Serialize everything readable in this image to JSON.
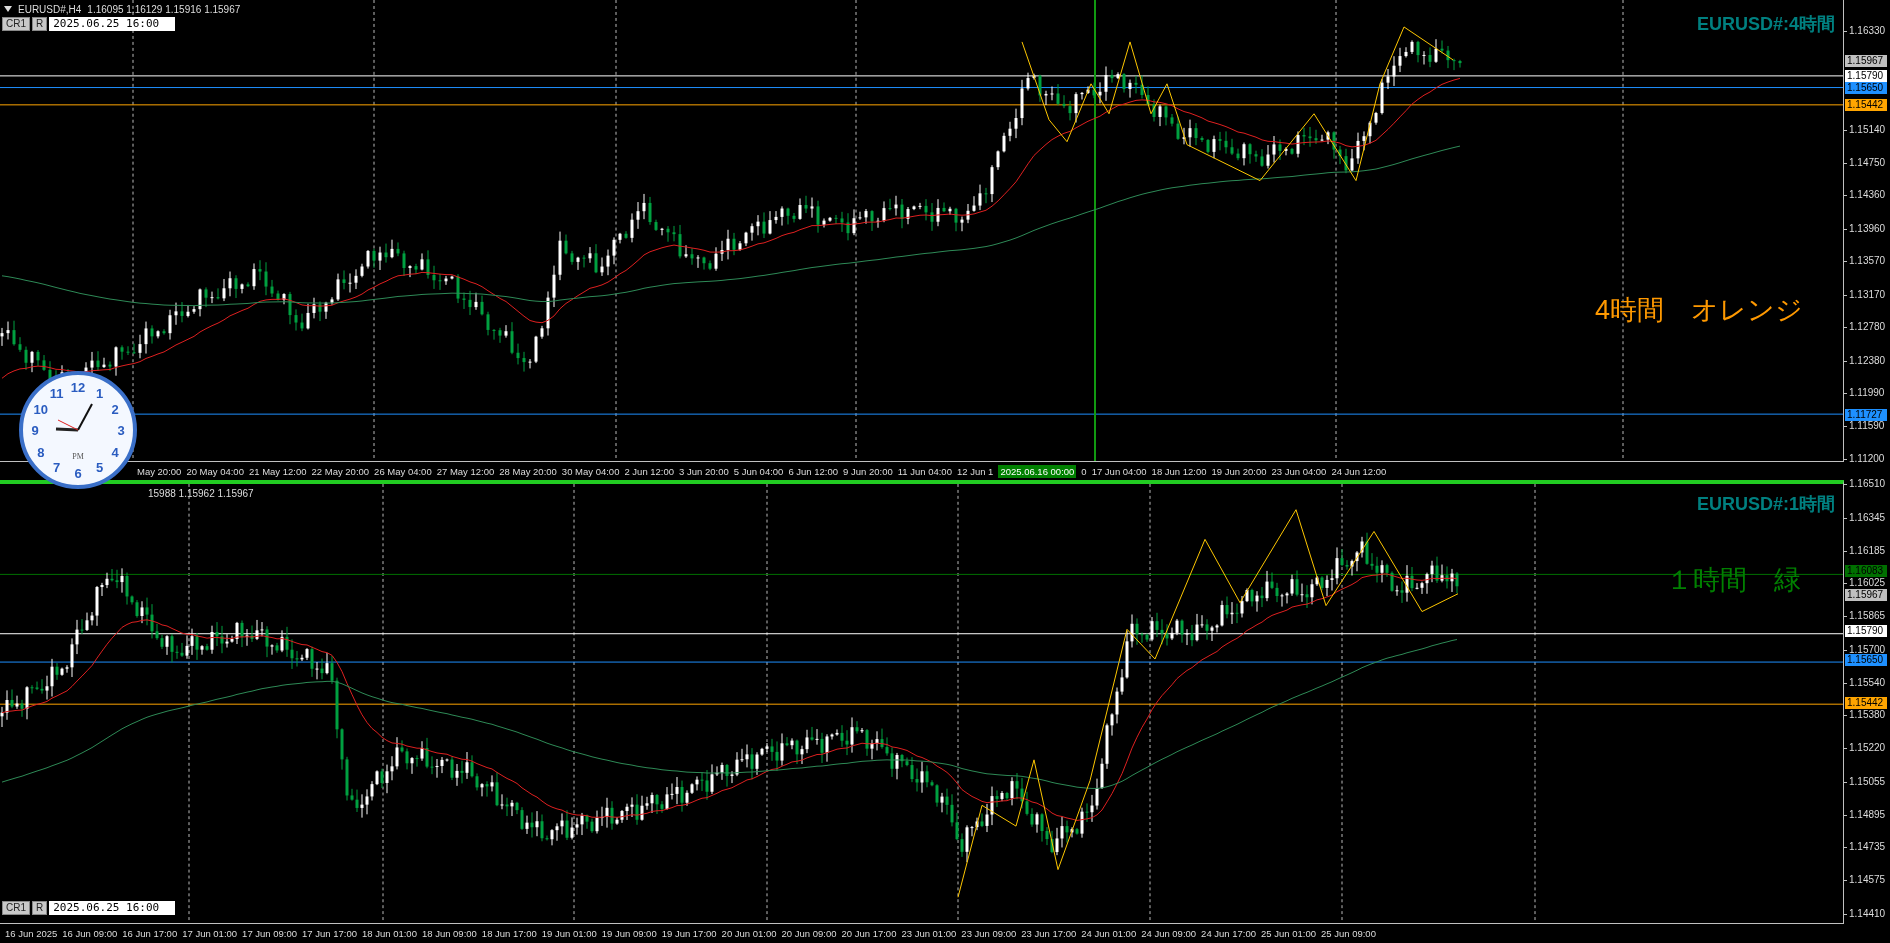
{
  "charts": [
    {
      "symbol": "EURUSD#,H4",
      "ohlc": "1.16095 1.16129 1.15916 1.15967",
      "active": false,
      "panel_buttons": [
        "CR1",
        "R"
      ],
      "date_field": "2025.06.25 16:00",
      "title": "EURUSD#:4時間",
      "note": {
        "text": "4時間　オレンジ",
        "color": "#ff9900"
      },
      "price_ticks": [
        "1.16330",
        "1.15140",
        "1.14750",
        "1.14360",
        "1.13960",
        "1.13570",
        "1.13170",
        "1.12780",
        "1.12380",
        "1.11990",
        "1.11590",
        "1.11200"
      ],
      "price_tags": [
        {
          "text": "1.15967",
          "kind": "bid",
          "color": "#c0c0c0"
        },
        {
          "text": "1.15790",
          "kind": "line",
          "color": "#ffffff"
        },
        {
          "text": "1.15650",
          "kind": "line",
          "color": "#1e90ff"
        },
        {
          "text": "1.15442",
          "kind": "line",
          "color": "#ffa500"
        },
        {
          "text": "1.11727",
          "kind": "line",
          "color": "#1e90ff"
        }
      ],
      "time_axis": [
        {
          "kind": "label",
          "text": "May 20:00"
        },
        {
          "kind": "label",
          "text": "20 May 04:00"
        },
        {
          "kind": "label",
          "text": "21 May 12:00"
        },
        {
          "kind": "label",
          "text": "22 May 20:00"
        },
        {
          "kind": "label",
          "text": "26 May 04:00"
        },
        {
          "kind": "label",
          "text": "27 May 12:00"
        },
        {
          "kind": "label",
          "text": "28 May 20:00"
        },
        {
          "kind": "label",
          "text": "30 May 04:00"
        },
        {
          "kind": "label",
          "text": "2 Jun 12:00"
        },
        {
          "kind": "label",
          "text": "3 Jun 20:00"
        },
        {
          "kind": "label",
          "text": "5 Jun 04:00"
        },
        {
          "kind": "label",
          "text": "6 Jun 12:00"
        },
        {
          "kind": "label",
          "text": "9 Jun 20:00"
        },
        {
          "kind": "label",
          "text": "11 Jun 04:00"
        },
        {
          "kind": "label",
          "text": "12 Jun 1"
        },
        {
          "kind": "cursor",
          "text": "2025.06.16 00:00"
        },
        {
          "kind": "label",
          "text": "0"
        },
        {
          "kind": "label",
          "text": "17 Jun 04:00"
        },
        {
          "kind": "label",
          "text": "18 Jun 12:00"
        },
        {
          "kind": "label",
          "text": "19 Jun 20:00"
        },
        {
          "kind": "label",
          "text": "23 Jun 04:00"
        },
        {
          "kind": "label",
          "text": "24 Jun 12:00"
        }
      ]
    },
    {
      "ohlc": "15988 1.15962 1.15967",
      "active": true,
      "panel_buttons": [
        "CR1",
        "R"
      ],
      "date_field": "2025.06.25 16:00",
      "title": "EURUSD#:1時間",
      "note": {
        "text": "１時間　緑",
        "color": "#008000"
      },
      "price_ticks": [
        "1.16510",
        "1.16345",
        "1.16185",
        "1.16025",
        "1.15865",
        "1.15700",
        "1.15540",
        "1.15380",
        "1.15220",
        "1.15055",
        "1.14895",
        "1.14735",
        "1.14575",
        "1.14410"
      ],
      "price_tags": [
        {
          "text": "1.16083",
          "kind": "line",
          "color": "#007000"
        },
        {
          "text": "1.15967",
          "kind": "bid",
          "color": "#c0c0c0"
        },
        {
          "text": "1.15790",
          "kind": "line",
          "color": "#ffffff"
        },
        {
          "text": "1.15650",
          "kind": "line",
          "color": "#1e90ff"
        },
        {
          "text": "1.15442",
          "kind": "line",
          "color": "#ffa500"
        }
      ],
      "time_axis": [
        {
          "kind": "label",
          "text": "16 Jun 2025"
        },
        {
          "kind": "label",
          "text": "16 Jun 09:00"
        },
        {
          "kind": "label",
          "text": "16 Jun 17:00"
        },
        {
          "kind": "label",
          "text": "17 Jun 01:00"
        },
        {
          "kind": "label",
          "text": "17 Jun 09:00"
        },
        {
          "kind": "label",
          "text": "17 Jun 17:00"
        },
        {
          "kind": "label",
          "text": "18 Jun 01:00"
        },
        {
          "kind": "label",
          "text": "18 Jun 09:00"
        },
        {
          "kind": "label",
          "text": "18 Jun 17:00"
        },
        {
          "kind": "label",
          "text": "19 Jun 01:00"
        },
        {
          "kind": "label",
          "text": "19 Jun 09:00"
        },
        {
          "kind": "label",
          "text": "19 Jun 17:00"
        },
        {
          "kind": "label",
          "text": "20 Jun 01:00"
        },
        {
          "kind": "label",
          "text": "20 Jun 09:00"
        },
        {
          "kind": "label",
          "text": "20 Jun 17:00"
        },
        {
          "kind": "label",
          "text": "23 Jun 01:00"
        },
        {
          "kind": "label",
          "text": "23 Jun 09:00"
        },
        {
          "kind": "label",
          "text": "23 Jun 17:00"
        },
        {
          "kind": "label",
          "text": "24 Jun 01:00"
        },
        {
          "kind": "label",
          "text": "24 Jun 09:00"
        },
        {
          "kind": "label",
          "text": "24 Jun 17:00"
        },
        {
          "kind": "label",
          "text": "25 Jun 01:00"
        },
        {
          "kind": "label",
          "text": "25 Jun 09:00"
        }
      ]
    }
  ],
  "clock": {
    "numerals": [
      "12",
      "11",
      "1",
      "10",
      "2",
      "9",
      "3",
      "8",
      "4",
      "7",
      "5",
      "6"
    ],
    "meridiem": "PM"
  }
}
